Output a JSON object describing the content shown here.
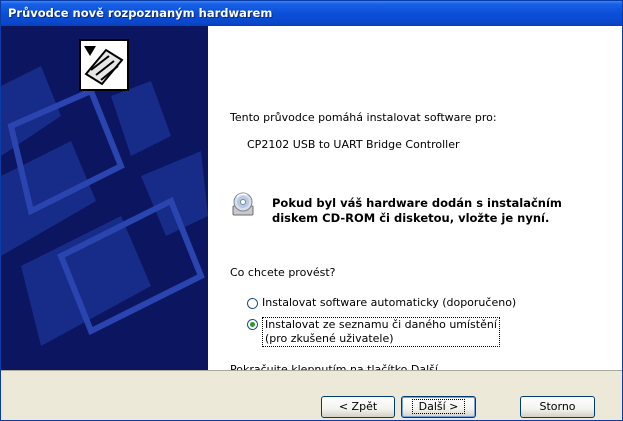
{
  "window": {
    "title": "Průvodce nově rozpoznaným hardwarem"
  },
  "main": {
    "intro": "Tento průvodce pomáhá instalovat software pro:",
    "device_name": "CP2102 USB to UART Bridge Controller",
    "cd_notice": "Pokud byl váš hardware dodán s instalačním diskem CD-ROM či disketou, vložte je nyní.",
    "question": "Co chcete provést?",
    "options": [
      {
        "label": "Instalovat software automaticky (doporučeno)",
        "checked": false
      },
      {
        "label_line1": "Instalovat ze seznamu či daného umístění",
        "label_line2": "(pro zkušené uživatele)",
        "checked": true
      }
    ],
    "continue_hint": "Pokračujte klepnutím na tlačítko Další."
  },
  "buttons": {
    "back": "< Zpět",
    "next": "Další >",
    "cancel": "Storno"
  },
  "icons": {
    "wizard": "hardware-install-icon",
    "cd": "cd-rom-icon"
  },
  "colors": {
    "titlebar": "#0a4fd8",
    "side_panel": "#0b1560",
    "footer": "#ece9d8",
    "radio_checked": "#21a121"
  }
}
